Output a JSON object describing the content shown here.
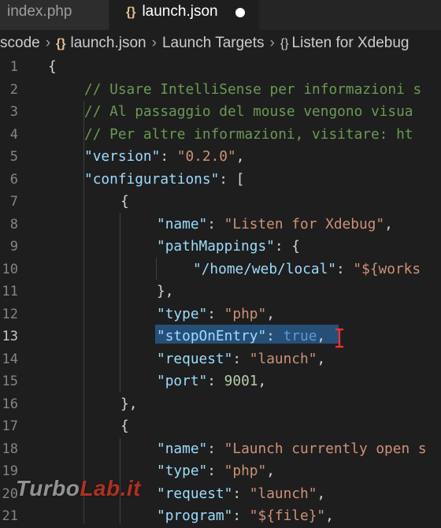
{
  "tabs": [
    {
      "label": "index.php",
      "active": false
    },
    {
      "label": "launch.json",
      "active": true,
      "icon": "{}",
      "modified": true
    }
  ],
  "breadcrumb": {
    "items": [
      "scode",
      "launch.json",
      "Launch Targets",
      "Listen for Xdebug"
    ]
  },
  "editor": {
    "active_line": 13,
    "lines": [
      {
        "n": "1"
      },
      {
        "n": "2"
      },
      {
        "n": "3"
      },
      {
        "n": "4"
      },
      {
        "n": "5"
      },
      {
        "n": "6"
      },
      {
        "n": "7"
      },
      {
        "n": "8"
      },
      {
        "n": "9"
      },
      {
        "n": "10"
      },
      {
        "n": "11"
      },
      {
        "n": "12"
      },
      {
        "n": "13"
      },
      {
        "n": "14"
      },
      {
        "n": "15"
      },
      {
        "n": "16"
      },
      {
        "n": "17"
      },
      {
        "n": "18"
      },
      {
        "n": "19"
      },
      {
        "n": "20"
      },
      {
        "n": "21"
      }
    ],
    "code": {
      "l1": "{",
      "l2": "// Usare IntelliSense per informazioni s",
      "l3": "// Al passaggio del mouse vengono visua",
      "l4": "// Per altre informazioni, visitare: ht",
      "l5_key": "\"version\"",
      "l5_val": "\"0.2.0\"",
      "l6_key": "\"configurations\"",
      "l6_rest": ": [",
      "l7": "{",
      "l8_key": "\"name\"",
      "l8_val": "\"Listen for Xdebug\"",
      "l9_key": "\"pathMappings\"",
      "l9_rest": ": {",
      "l10_key": "\"/home/web/local\"",
      "l10_val": "\"${works",
      "l11": "},",
      "l12_key": "\"type\"",
      "l12_val": "\"php\"",
      "l13_key": "\"stopOnEntry\"",
      "l13_val": "true",
      "l14_key": "\"request\"",
      "l14_val": "\"launch\"",
      "l15_key": "\"port\"",
      "l15_val": "9001",
      "l16": "},",
      "l17": "{",
      "l18_key": "\"name\"",
      "l18_val": "\"Launch currently open s",
      "l19_key": "\"type\"",
      "l19_val": "\"php\"",
      "l20_key": "\"request\"",
      "l20_val": "\"launch\"",
      "l21_key": "\"program\"",
      "l21_val": "\"${file}\""
    }
  },
  "watermark": {
    "part1": "Turbo",
    "part2": "Lab.it"
  },
  "colors": {
    "editor_bg": "#1e1e1e",
    "key": "#9cdcfe",
    "string": "#ce9178",
    "comment": "#6a9955",
    "number": "#b5cea8",
    "boolean": "#569cd6",
    "selection": "#264f78",
    "folder_icon": "#e2c08d"
  }
}
